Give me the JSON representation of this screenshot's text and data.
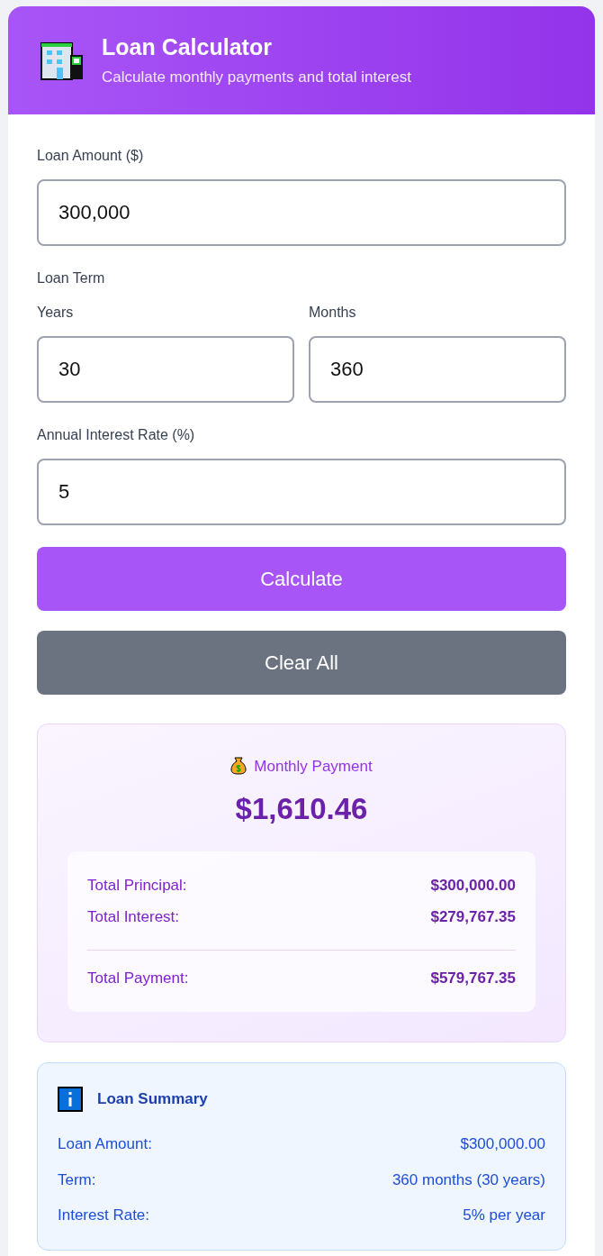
{
  "header": {
    "title": "Loan Calculator",
    "subtitle": "Calculate monthly payments and total interest"
  },
  "loan_amount": {
    "label": "Loan Amount ($)",
    "value": "300,000"
  },
  "loan_term": {
    "label": "Loan Term",
    "fields": [
      {
        "label": "Years",
        "value": "30"
      },
      {
        "label": "Months",
        "value": "360"
      }
    ]
  },
  "interest_rate": {
    "label": "Annual Interest Rate (%)",
    "value": "5"
  },
  "buttons": [
    {
      "label": "Calculate",
      "kind": "primary"
    },
    {
      "label": "Clear All",
      "kind": "secondary"
    }
  ],
  "result": {
    "label": "Monthly Payment",
    "amount": "$1,610.46",
    "breakdown": [
      {
        "label": "Total Principal:",
        "value": "$300,000.00",
        "kind": "item"
      },
      {
        "label": "Total Interest:",
        "value": "$279,767.35",
        "kind": "item"
      },
      {
        "label": "Total Payment:",
        "value": "$579,767.35",
        "kind": "total"
      }
    ]
  },
  "summary": {
    "title": "Loan Summary",
    "rows": [
      {
        "label": "Loan Amount:",
        "value": "$300,000.00"
      },
      {
        "label": "Term:",
        "value": "360 months (30 years)"
      },
      {
        "label": "Interest Rate:",
        "value": "5% per year"
      }
    ]
  }
}
